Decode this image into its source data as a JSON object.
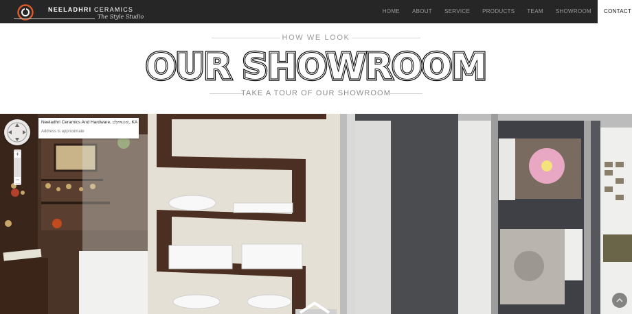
{
  "header": {
    "brand_name_bold": "NEELADHRI",
    "brand_name_rest": " CERAMICS",
    "brand_tagline": "The Style Studio",
    "nav": [
      {
        "label": "HOME",
        "active": false
      },
      {
        "label": "ABOUT",
        "active": false
      },
      {
        "label": "SERVICE",
        "active": false
      },
      {
        "label": "PRODUCTS",
        "active": false
      },
      {
        "label": "TEAM",
        "active": false
      },
      {
        "label": "SHOWROOM",
        "active": false
      },
      {
        "label": "CONTACT",
        "active": true
      }
    ]
  },
  "hero": {
    "eyebrow": "HOW WE LOOK",
    "title": "OUR SHOWROOM",
    "subtitle": "TAKE A TOUR OF OUR SHOWROOM"
  },
  "tour": {
    "place_name": "Neeladhri Ceramics And Hardware, ಬೆಂಗಳೂರು, KA",
    "address_note": "Address is approximate",
    "zoom_in": "+",
    "zoom_out": "−"
  },
  "colors": {
    "nav_bg": "#262626",
    "accent": "#e05a2a",
    "title": "#111111"
  },
  "icons": [
    "logo-mark-icon",
    "compass-icon",
    "zoom-in-icon",
    "zoom-out-icon",
    "navigate-forward-arrow-icon",
    "street-view-corner-icon"
  ]
}
